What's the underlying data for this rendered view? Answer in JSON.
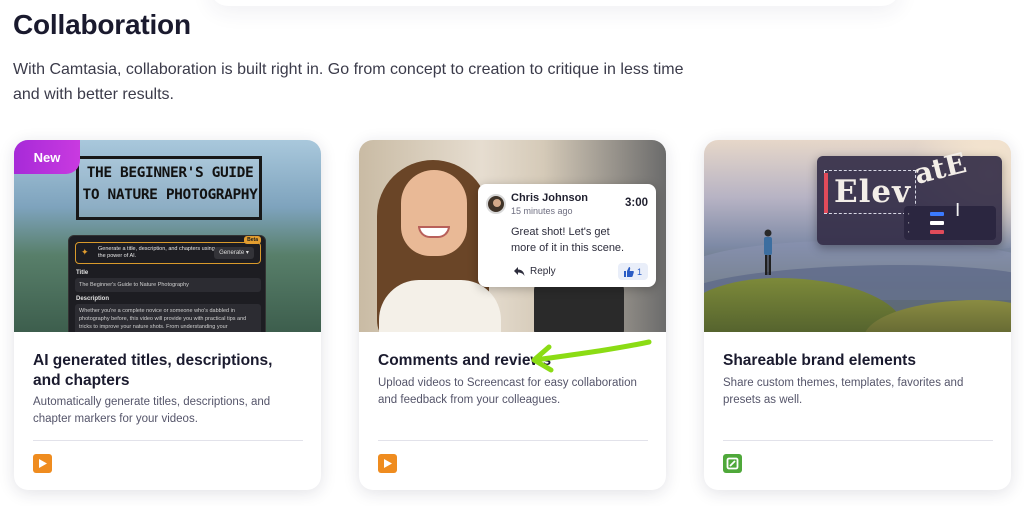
{
  "heading": "Collaboration",
  "intro": "With Camtasia, collaboration is built right in. Go from concept to creation to critique in less time and with better results.",
  "colors": {
    "badge": "#b430dc",
    "orange_icon": "#ef8c1f",
    "green_icon": "#4fa83a",
    "arrow": "#8bdc14"
  },
  "cards": [
    {
      "badge": "New",
      "title": "AI generated titles, descriptions, and chapters",
      "description": "Automatically generate titles, descriptions, and chapter markers for your videos.",
      "icon": "camtasia-orange-play-icon",
      "thumb": {
        "headline": "THE BEGINNER'S GUIDE TO NATURE PHOTOGRAPHY",
        "generate_text": "Generate a title, description, and chapters using the power of AI.",
        "generate_button": "Generate",
        "beta": "Beta",
        "title_label": "Title",
        "title_value": "The Beginner's Guide to Nature Photography",
        "description_label": "Description",
        "description_value": "Whether you're a complete novice or someone who's dabbled in photography before, this video will provide you with practical tips and tricks to improve your nature shots. From understanding your"
      }
    },
    {
      "title": "Comments and reviews",
      "description": "Upload videos to Screencast for easy collaboration and feedback from your colleagues.",
      "icon": "camtasia-orange-play-icon",
      "thumb": {
        "comment_author": "Chris Johnson",
        "comment_time": "15 minutes ago",
        "comment_timestamp": "3:00",
        "comment_text": "Great shot! Let's get more of it in this scene.",
        "reply_label": "Reply",
        "like_count": "1"
      }
    },
    {
      "title": "Shareable brand elements",
      "description": "Share custom themes, templates, favorites and presets as well.",
      "icon": "snagit-green-icon",
      "thumb": {
        "text_main": "Elev",
        "text_curve": "atE"
      }
    }
  ]
}
